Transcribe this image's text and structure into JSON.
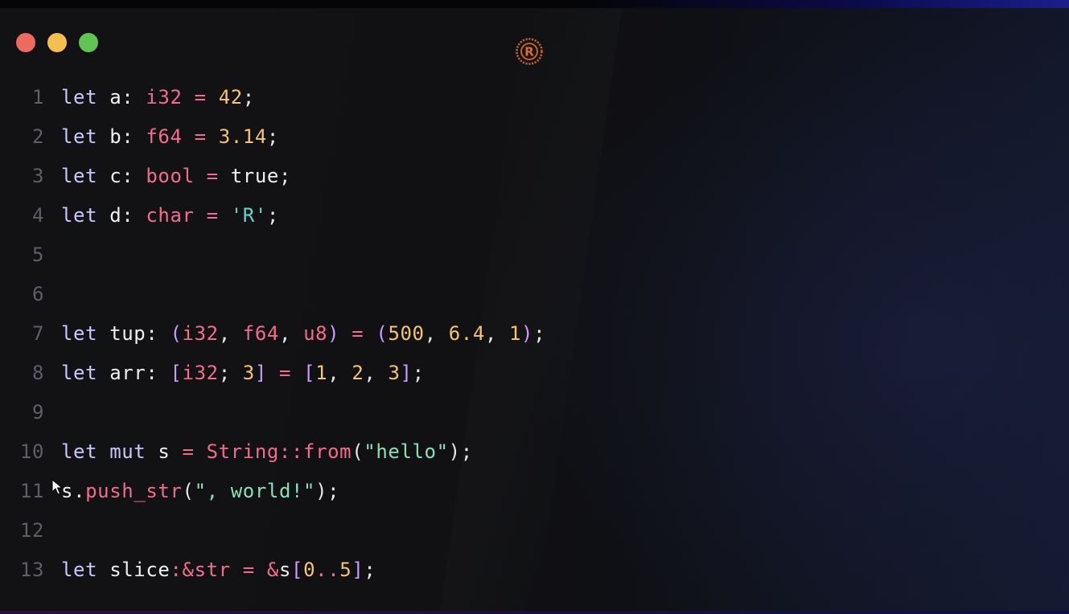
{
  "window": {
    "traffic_lights": [
      {
        "name": "close",
        "color": "#ed6a5e"
      },
      {
        "name": "minimize",
        "color": "#f5bf4f"
      },
      {
        "name": "maximize",
        "color": "#61c554"
      }
    ],
    "logo_icon": "rust-logo-icon"
  },
  "code": {
    "lines": [
      {
        "n": "1",
        "tokens": [
          [
            "kw",
            "let"
          ],
          [
            "id",
            " a"
          ],
          [
            "pun",
            ": "
          ],
          [
            "ty",
            "i32"
          ],
          [
            "op",
            " = "
          ],
          [
            "num",
            "42"
          ],
          [
            "pun",
            ";"
          ]
        ]
      },
      {
        "n": "2",
        "tokens": [
          [
            "kw",
            "let"
          ],
          [
            "id",
            " b"
          ],
          [
            "pun",
            ": "
          ],
          [
            "ty",
            "f64"
          ],
          [
            "op",
            " = "
          ],
          [
            "num",
            "3.14"
          ],
          [
            "pun",
            ";"
          ]
        ]
      },
      {
        "n": "3",
        "tokens": [
          [
            "kw",
            "let"
          ],
          [
            "id",
            " c"
          ],
          [
            "pun",
            ": "
          ],
          [
            "ty",
            "bool"
          ],
          [
            "op",
            " = "
          ],
          [
            "id",
            "true"
          ],
          [
            "pun",
            ";"
          ]
        ]
      },
      {
        "n": "4",
        "tokens": [
          [
            "kw",
            "let"
          ],
          [
            "id",
            " d"
          ],
          [
            "pun",
            ": "
          ],
          [
            "ty",
            "char"
          ],
          [
            "op",
            " = "
          ],
          [
            "chr",
            "'R'"
          ],
          [
            "pun",
            ";"
          ]
        ]
      },
      {
        "n": "5",
        "tokens": []
      },
      {
        "n": "6",
        "tokens": []
      },
      {
        "n": "7",
        "tokens": [
          [
            "kw",
            "let"
          ],
          [
            "id",
            " tup"
          ],
          [
            "pun",
            ": "
          ],
          [
            "br",
            "("
          ],
          [
            "ty",
            "i32"
          ],
          [
            "pun",
            ", "
          ],
          [
            "ty",
            "f64"
          ],
          [
            "pun",
            ", "
          ],
          [
            "ty",
            "u8"
          ],
          [
            "br",
            ")"
          ],
          [
            "op",
            " = "
          ],
          [
            "br",
            "("
          ],
          [
            "num",
            "500"
          ],
          [
            "pun",
            ", "
          ],
          [
            "num",
            "6.4"
          ],
          [
            "pun",
            ", "
          ],
          [
            "num",
            "1"
          ],
          [
            "br",
            ")"
          ],
          [
            "pun",
            ";"
          ]
        ]
      },
      {
        "n": "8",
        "tokens": [
          [
            "kw",
            "let"
          ],
          [
            "id",
            " arr"
          ],
          [
            "pun",
            ": "
          ],
          [
            "br",
            "["
          ],
          [
            "ty",
            "i32"
          ],
          [
            "pun",
            "; "
          ],
          [
            "num",
            "3"
          ],
          [
            "br",
            "]"
          ],
          [
            "op",
            " = "
          ],
          [
            "br",
            "["
          ],
          [
            "num",
            "1"
          ],
          [
            "pun",
            ", "
          ],
          [
            "num",
            "2"
          ],
          [
            "pun",
            ", "
          ],
          [
            "num",
            "3"
          ],
          [
            "br",
            "]"
          ],
          [
            "pun",
            ";"
          ]
        ]
      },
      {
        "n": "9",
        "tokens": []
      },
      {
        "n": "10",
        "tokens": [
          [
            "kw",
            "let"
          ],
          [
            "kw",
            " mut"
          ],
          [
            "id",
            " s"
          ],
          [
            "op",
            " = "
          ],
          [
            "fn",
            "String"
          ],
          [
            "op",
            "::"
          ],
          [
            "fn",
            "from"
          ],
          [
            "pun",
            "("
          ],
          [
            "str",
            "\"hello\""
          ],
          [
            "pun",
            ")"
          ],
          [
            "pun",
            ";"
          ]
        ]
      },
      {
        "n": "11",
        "tokens": [
          [
            "id",
            "s"
          ],
          [
            "pun",
            "."
          ],
          [
            "fn",
            "push_str"
          ],
          [
            "pun",
            "("
          ],
          [
            "str",
            "\", world!\""
          ],
          [
            "pun",
            ")"
          ],
          [
            "pun",
            ";"
          ]
        ]
      },
      {
        "n": "12",
        "tokens": []
      },
      {
        "n": "13",
        "tokens": [
          [
            "kw",
            "let"
          ],
          [
            "id",
            " slice"
          ],
          [
            "op",
            ":"
          ],
          [
            "op",
            "&"
          ],
          [
            "ty",
            "str"
          ],
          [
            "op",
            " = "
          ],
          [
            "op",
            "&"
          ],
          [
            "id",
            "s"
          ],
          [
            "br",
            "["
          ],
          [
            "num",
            "0"
          ],
          [
            "op",
            ".."
          ],
          [
            "num",
            "5"
          ],
          [
            "br",
            "]"
          ],
          [
            "pun",
            ";"
          ]
        ]
      }
    ]
  }
}
